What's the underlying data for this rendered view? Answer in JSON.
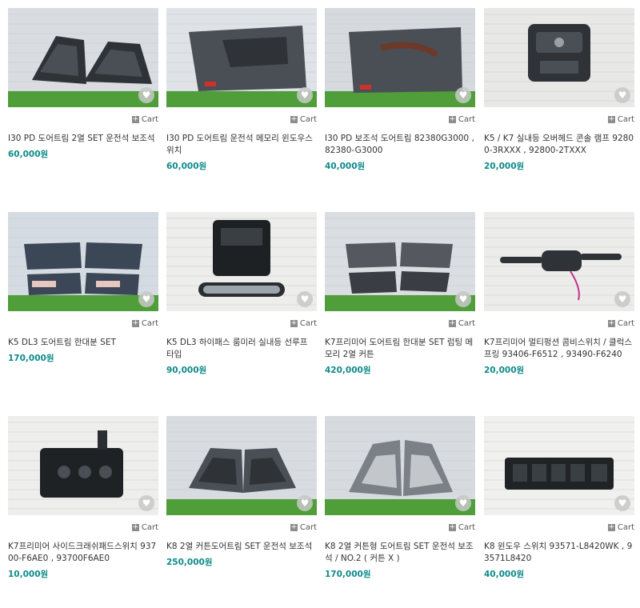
{
  "products": [
    {
      "title": "I30 PD 도어트림 2열 SET 운전석 보조석",
      "price": "60,000원",
      "cart_label": "Cart",
      "image": "door-trim-pair",
      "bg": "#d9dde2",
      "floor": "#4f9e3a"
    },
    {
      "title": "I30 PD 도어트림 운전석 메모리 윈도우스위치",
      "price": "60,000원",
      "cart_label": "Cart",
      "image": "door-trim-single",
      "bg": "#dfe2e6",
      "floor": "#4f9e3a"
    },
    {
      "title": "I30 PD 보조석 도어트림 82380G3000 , 82380-G3000",
      "price": "40,000원",
      "cart_label": "Cart",
      "image": "door-trim-brown",
      "bg": "#d6dadf",
      "floor": "#4f9e3a"
    },
    {
      "title": "K5 / K7 실내등 오버헤드 콘솔 램프 92800-3RXXX , 92800-2TXXX",
      "price": "20,000원",
      "cart_label": "Cart",
      "image": "overhead-console",
      "bg": "#e8e8e6",
      "floor": "#e8e8e6"
    },
    {
      "title": "K5 DL3 도어트림 한대분 SET",
      "price": "170,000원",
      "cart_label": "Cart",
      "image": "door-trim-set-blue",
      "bg": "#d5dbe2",
      "floor": "#4f9e3a"
    },
    {
      "title": "K5 DL3 하이패스 룸미러 실내등 선루프 타입",
      "price": "90,000원",
      "cart_label": "Cart",
      "image": "room-mirror",
      "bg": "#ededeb",
      "floor": "#ededeb"
    },
    {
      "title": "K7프리미어 도어트림 한대분 SET 럼팅 메모리 2열 커튼",
      "price": "420,000원",
      "cart_label": "Cart",
      "image": "door-trim-set-gray",
      "bg": "#dadde1",
      "floor": "#4f9e3a"
    },
    {
      "title": "K7프리미어 멀티펑션 콤비스위치 / 클럭스프링 93406-F6512 , 93490-F6240",
      "price": "20,000원",
      "cart_label": "Cart",
      "image": "combi-switch",
      "bg": "#ececea",
      "floor": "#ececea"
    },
    {
      "title": "K7프리미어 사이드크래쉬패드스위치 93700-F6AE0 , 93700F6AE0",
      "price": "10,000원",
      "cart_label": "Cart",
      "image": "side-switch",
      "bg": "#eeeeec",
      "floor": "#eeeeec"
    },
    {
      "title": "K8 2열 커튼도어트림 SET 운전석 보조석",
      "price": "250,000원",
      "cart_label": "Cart",
      "image": "door-trim-pair-k8",
      "bg": "#d8dce1",
      "floor": "#4f9e3a"
    },
    {
      "title": "K8 2열 커튼형 도어트림 SET 운전석 보조석 / NO.2 ( 커튼 X )",
      "price": "170,000원",
      "cart_label": "Cart",
      "image": "door-trim-pair-silver",
      "bg": "#d7dbe0",
      "floor": "#4f9e3a"
    },
    {
      "title": "K8 윈도우 스위치 93571-L8420WK , 93571L8420",
      "price": "40,000원",
      "cart_label": "Cart",
      "image": "window-switch",
      "bg": "#f0f0ee",
      "floor": "#f0f0ee"
    }
  ],
  "wishlist_icon": "heart-icon",
  "cart_icon": "plus-icon"
}
